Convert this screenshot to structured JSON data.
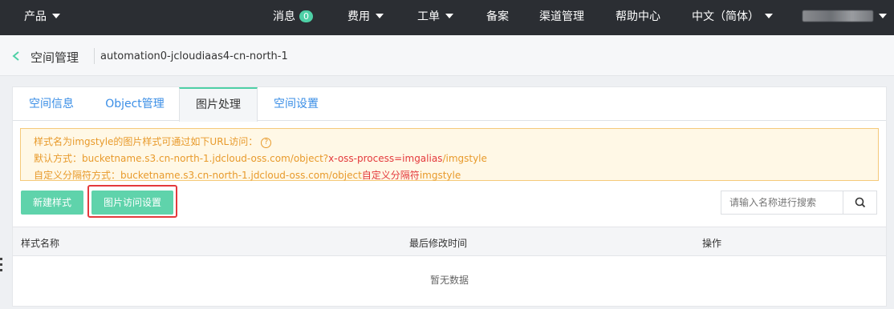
{
  "topnav": {
    "products": "产品",
    "messages": "消息",
    "messages_count": "0",
    "billing": "费用",
    "tickets": "工单",
    "filing": "备案",
    "channel": "渠道管理",
    "help": "帮助中心",
    "language": "中文（简体）"
  },
  "breadcrumb": {
    "title": "空间管理",
    "bucket": "automation0-jcloudiaas4-cn-north-1"
  },
  "tabs": [
    {
      "label": "空间信息"
    },
    {
      "label": "Object管理"
    },
    {
      "label": "图片处理"
    },
    {
      "label": "空间设置"
    }
  ],
  "notice": {
    "line1": "样式名为imgstyle的图片样式可通过如下URL访问：",
    "line2_prefix": "默认方式：bucketname.s3.cn-north-1.jdcloud-oss.com/object?",
    "line2_highlight": "x-oss-process=imgalias",
    "line2_suffix": "/imgstyle",
    "line3_prefix": "自定义分隔符方式：bucketname.s3.cn-north-1.jdcloud-oss.com/object",
    "line3_highlight": "自定义分隔符",
    "line3_suffix": "imgstyle"
  },
  "toolbar": {
    "new_style": "新建样式",
    "access_settings": "图片访问设置",
    "search_placeholder": "请输入名称进行搜索"
  },
  "table": {
    "columns": [
      "样式名称",
      "最后修改时间",
      "操作"
    ],
    "empty_text": "暂无数据"
  },
  "colors": {
    "nav_bg": "#2b2e33",
    "accent_green": "#5fd3ab",
    "link_blue": "#3a8ee6",
    "notice_orange": "#e89a2b",
    "highlight_red": "#e4393c"
  },
  "icons": [
    "chevron-left-icon",
    "caret-down-icon",
    "help-circle-icon",
    "search-icon"
  ]
}
